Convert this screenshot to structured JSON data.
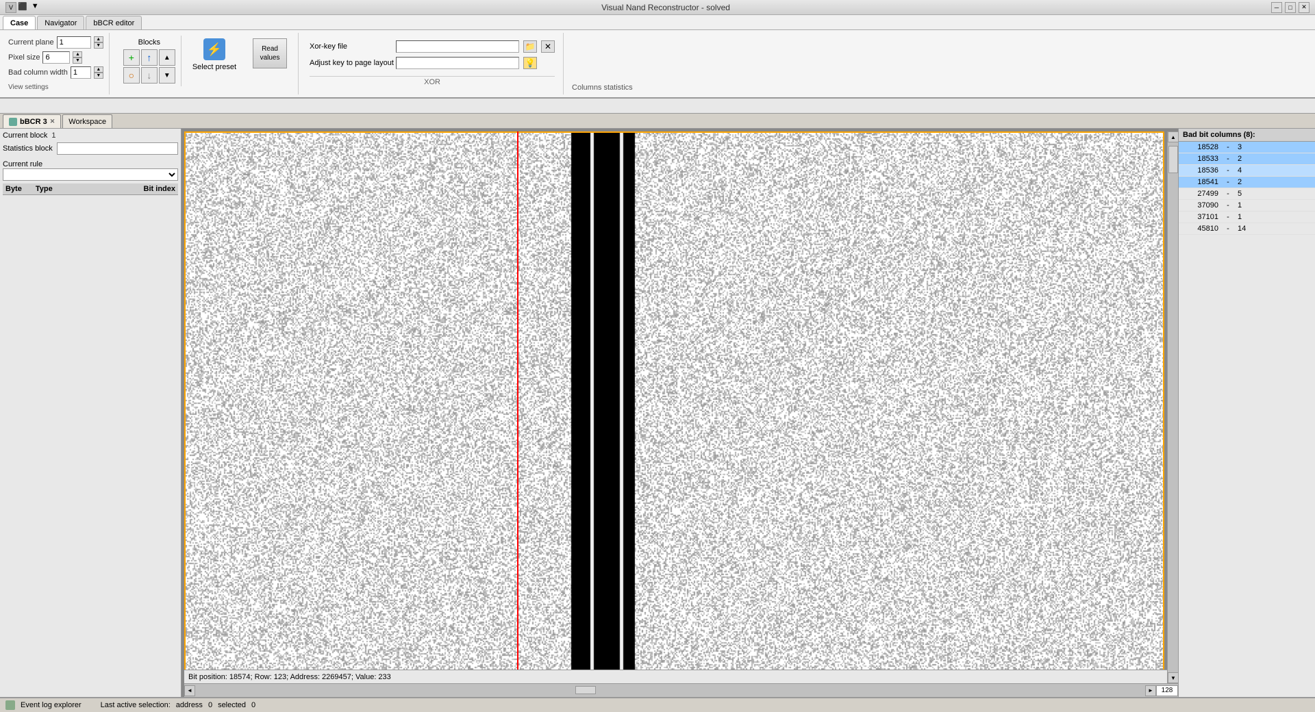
{
  "window": {
    "title": "Visual Nand Reconstructor - solved",
    "minimize": "─",
    "restore": "□",
    "close": "✕"
  },
  "menutabs": [
    {
      "label": "Case",
      "active": true
    },
    {
      "label": "Navigator",
      "active": false
    },
    {
      "label": "bBCR editor",
      "active": false
    }
  ],
  "toolbar": {
    "current_plane_label": "Current plane",
    "current_plane_value": "1",
    "pixel_size_label": "Pixel size",
    "pixel_size_value": "6",
    "bad_col_width_label": "Bad column width",
    "bad_col_width_value": "1",
    "blocks_label": "Blocks",
    "select_preset_label": "Select preset",
    "read_values_label": "Read\nvalues",
    "xor_key_file_label": "Xor-key file",
    "xor_key_file_value": "",
    "adjust_key_label": "Adjust key to page layout",
    "adjust_key_value": "",
    "xor_section_label": "XOR",
    "columns_stats_label": "Columns statistics",
    "view_settings_label": "View settings"
  },
  "workspace_tabs": [
    {
      "label": "bBCR 3",
      "active": true,
      "closable": true
    },
    {
      "label": "Workspace",
      "active": false,
      "closable": false
    }
  ],
  "left_panel": {
    "current_block_label": "Current block",
    "current_block_value": "1",
    "statistics_block_label": "Statistics block",
    "statistics_block_value": "",
    "current_rule_label": "Current rule",
    "current_rule_value": "",
    "col_byte_label": "Byte",
    "col_type_label": "Type",
    "col_bit_index_label": "Bit index"
  },
  "bad_bit_columns": {
    "header": "Bad bit columns (8):",
    "items": [
      {
        "col": "18528",
        "dash": "-",
        "val": "3",
        "selected": true
      },
      {
        "col": "18533",
        "dash": "-",
        "val": "2",
        "selected": true
      },
      {
        "col": "18536",
        "dash": "-",
        "val": "4",
        "selected": true
      },
      {
        "col": "18541",
        "dash": "-",
        "val": "2",
        "selected": true
      },
      {
        "col": "27499",
        "dash": "-",
        "val": "5",
        "selected": false
      },
      {
        "col": "37090",
        "dash": "-",
        "val": "1",
        "selected": false
      },
      {
        "col": "37101",
        "dash": "-",
        "val": "1",
        "selected": false
      },
      {
        "col": "45810",
        "dash": "-",
        "val": "14",
        "selected": false
      }
    ]
  },
  "statusbar": {
    "bit_position": "Bit position: 18574; Row: 123; Address: 2269457; Value: 233",
    "page_num": "128"
  },
  "bottombar": {
    "event_log_label": "Event log explorer",
    "last_active_label": "Last active selection:",
    "last_active_type": "address",
    "last_active_value": "0",
    "selected_label": "selected",
    "selected_value": "0"
  }
}
